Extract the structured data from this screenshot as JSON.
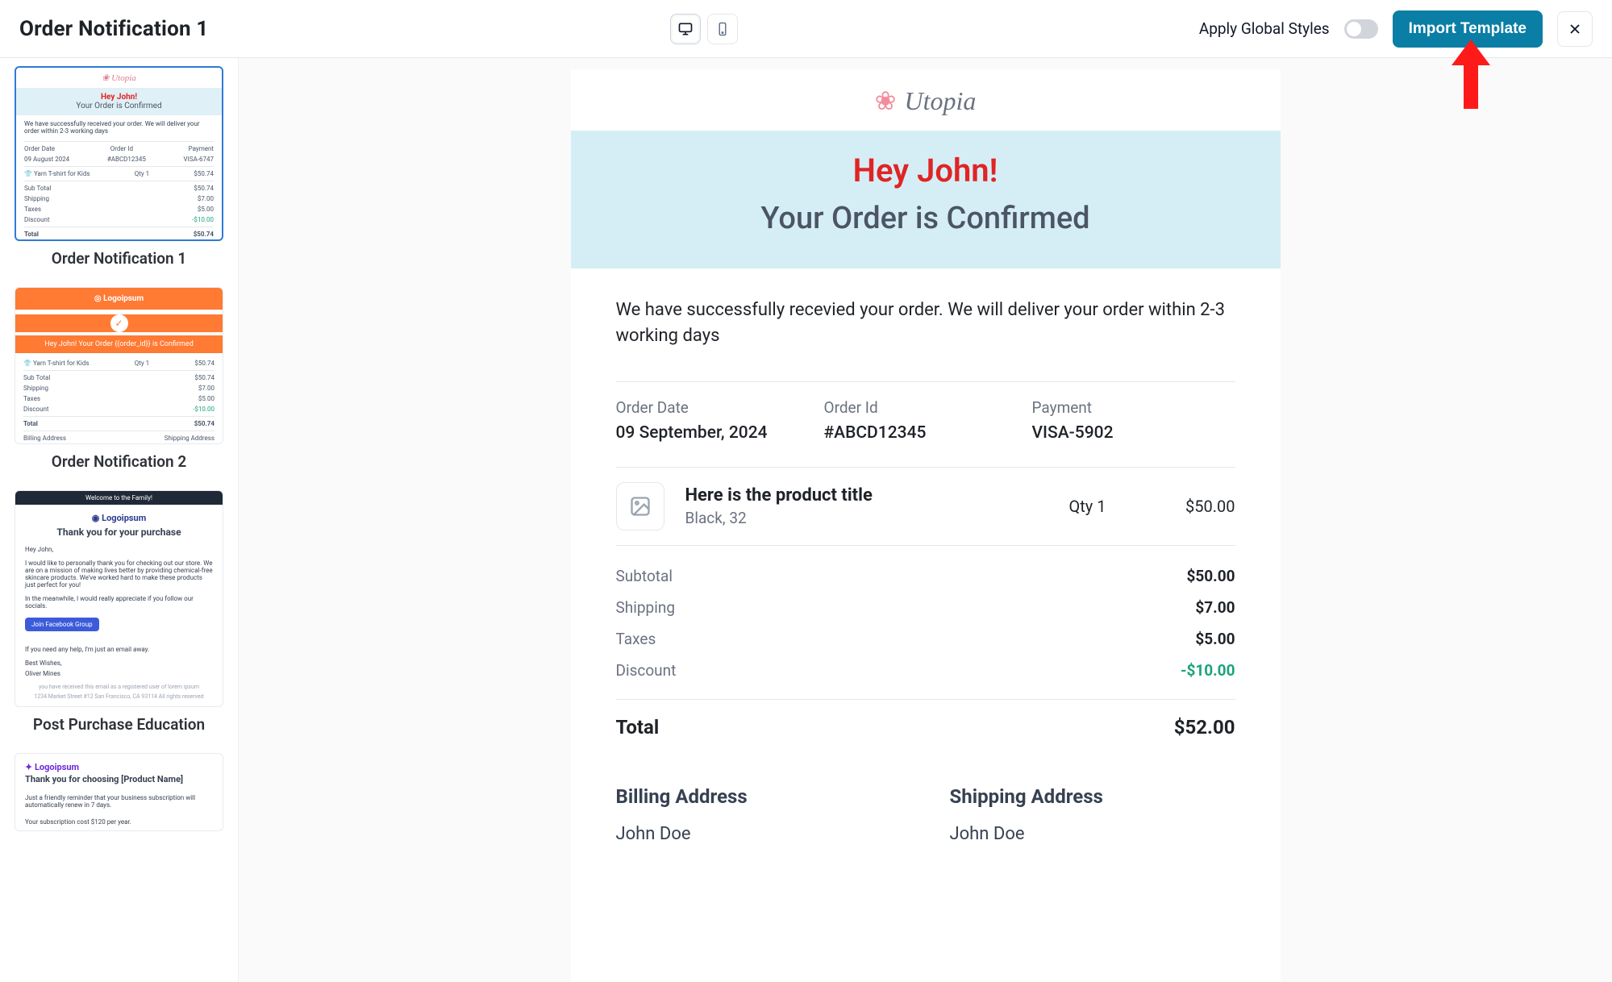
{
  "header": {
    "title": "Order Notification 1",
    "apply_global_label": "Apply Global Styles",
    "import_button": "Import Template"
  },
  "sidebar": {
    "templates": [
      {
        "title": "Order Notification 1",
        "selected": true
      },
      {
        "title": "Order Notification 2",
        "selected": false
      },
      {
        "title": "Post Purchase Education",
        "selected": false
      }
    ]
  },
  "preview": {
    "brand": "Utopia",
    "greeting": "Hey John!",
    "confirmed": "Your Order is Confirmed",
    "intro": "We have successfully recevied your order. We will deliver your order within 2-3 working days",
    "meta": {
      "order_date_label": "Order Date",
      "order_date": "09 September, 2024",
      "order_id_label": "Order Id",
      "order_id": "#ABCD12345",
      "payment_label": "Payment",
      "payment": "VISA-5902"
    },
    "item": {
      "title": "Here is the product title",
      "variant": "Black, 32",
      "qty": "Qty 1",
      "price": "$50.00"
    },
    "totals": {
      "subtotal_label": "Subtotal",
      "subtotal": "$50.00",
      "shipping_label": "Shipping",
      "shipping": "$7.00",
      "taxes_label": "Taxes",
      "taxes": "$5.00",
      "discount_label": "Discount",
      "discount": "-$10.00",
      "total_label": "Total",
      "total": "$52.00"
    },
    "billing": {
      "heading": "Billing Address",
      "name": "John Doe"
    },
    "shipping": {
      "heading": "Shipping Address",
      "name": "John Doe"
    }
  },
  "thumbs": {
    "t1": {
      "brand": "Utopia",
      "hey": "Hey John!",
      "conf": "Your Order is Confirmed",
      "intro": "We have successfully received your order. We will deliver your order within 2-3 working days",
      "date_lbl": "Order Date",
      "date": "09 August 2024",
      "id_lbl": "Order Id",
      "id": "#ABCD12345",
      "pay_lbl": "Payment",
      "pay": "VISA-6747",
      "prod": "Yarn T-shirt for Kids",
      "qty": "Qty 1",
      "price": "$50.74",
      "subtotal_lbl": "Sub Total",
      "subtotal": "$50.74",
      "ship_lbl": "Shipping",
      "ship": "$7.00",
      "tax_lbl": "Taxes",
      "tax": "$5.00",
      "disc_lbl": "Discount",
      "disc": "-$10.00",
      "total_lbl": "Total",
      "total": "$50.74"
    },
    "t2": {
      "logo": "Logoipsum",
      "msg": "Hey John! Your Order {{order_id}} is Confirmed",
      "prod": "Yarn T-shirt for Kids",
      "qty": "Qty 1",
      "price": "$50.74",
      "subtotal_lbl": "Sub Total",
      "subtotal": "$50.74",
      "ship_lbl": "Shipping",
      "ship": "$7.00",
      "tax_lbl": "Taxes",
      "tax": "$5.00",
      "disc_lbl": "Discount",
      "disc": "-$10.00",
      "total_lbl": "Total",
      "total": "$50.74",
      "bill": "Billing Address",
      "shipaddr": "Shipping Address"
    },
    "t3": {
      "bar": "Welcome to the Family!",
      "logo": "Logoipsum",
      "thank": "Thank you for your purchase",
      "hi": "Hey John,",
      "p1": "I would like to personally thank you for checking out our store. We are on a mission of making lives better by providing chemical-free skincare products. We've worked hard to make these products just perfect for you!",
      "p2": "In the meanwhile, I would really appreciate if you follow our socials.",
      "cta": "Join Facebook Group",
      "p3": "If you need any help, I'm just an email away.",
      "sign1": "Best Wishes,",
      "sign2": "Oliver Mines",
      "foot1": "you have received this email as a registered user of lorem ipsum",
      "foot2": "1234 Market Street #12 San Francisco, CA 93114 All rights reserved"
    },
    "t4": {
      "logo": "Logoipsum",
      "h": "Thank you for choosing [Product Name]",
      "p1": "Just a friendly reminder that your business subscription will automatically renew in 7 days.",
      "p2": "Your subscription cost $120 per year."
    }
  }
}
